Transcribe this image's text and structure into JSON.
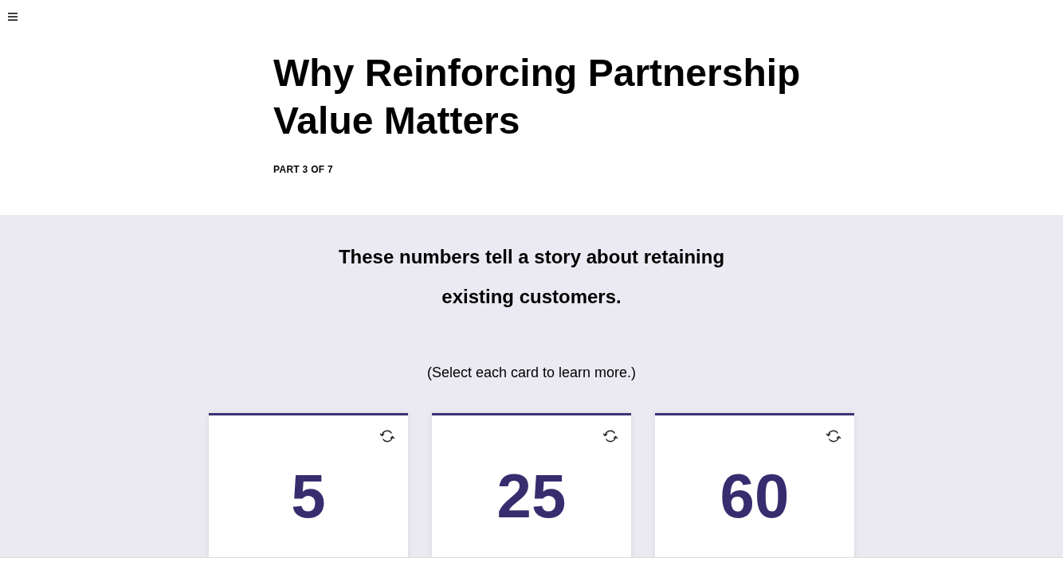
{
  "title": "Why Reinforcing Partnership Value Matters",
  "part_label": "PART 3 OF 7",
  "section": {
    "heading": "These numbers tell a story about retaining existing customers.",
    "instruction": "(Select each card to learn more.)"
  },
  "cards": [
    {
      "number": "5"
    },
    {
      "number": "25"
    },
    {
      "number": "60"
    }
  ]
}
